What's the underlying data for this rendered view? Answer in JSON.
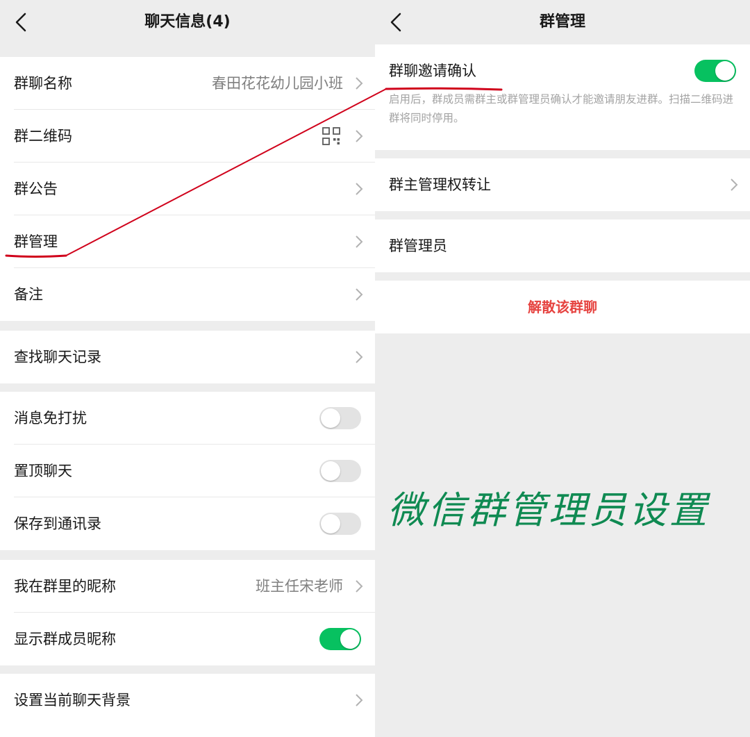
{
  "left": {
    "title": "聊天信息(4)",
    "group1": {
      "group_name_label": "群聊名称",
      "group_name_value": "春田花花幼儿园小班",
      "qrcode_label": "群二维码",
      "notice_label": "群公告",
      "manage_label": "群管理",
      "remark_label": "备注"
    },
    "group2": {
      "search_history_label": "查找聊天记录"
    },
    "group3": {
      "mute_label": "消息免打扰",
      "mute_on": false,
      "pin_label": "置顶聊天",
      "pin_on": false,
      "save_contacts_label": "保存到通讯录",
      "save_contacts_on": false
    },
    "group4": {
      "nickname_label": "我在群里的昵称",
      "nickname_value": "班主任宋老师",
      "show_nicknames_label": "显示群成员昵称",
      "show_nicknames_on": true
    },
    "group5": {
      "background_label": "设置当前聊天背景"
    }
  },
  "right": {
    "title": "群管理",
    "invite_confirm_label": "群聊邀请确认",
    "invite_confirm_on": true,
    "invite_confirm_desc": "启用后，群成员需群主或群管理员确认才能邀请朋友进群。扫描二维码进群将同时停用。",
    "transfer_owner_label": "群主管理权转让",
    "admins_label": "群管理员",
    "disband_label": "解散该群聊"
  },
  "caption": "微信群管理员设置",
  "colors": {
    "accent_green": "#07c160",
    "danger_red": "#e64340",
    "annotation_red": "#d0021b",
    "caption_green": "#0f8a52"
  }
}
